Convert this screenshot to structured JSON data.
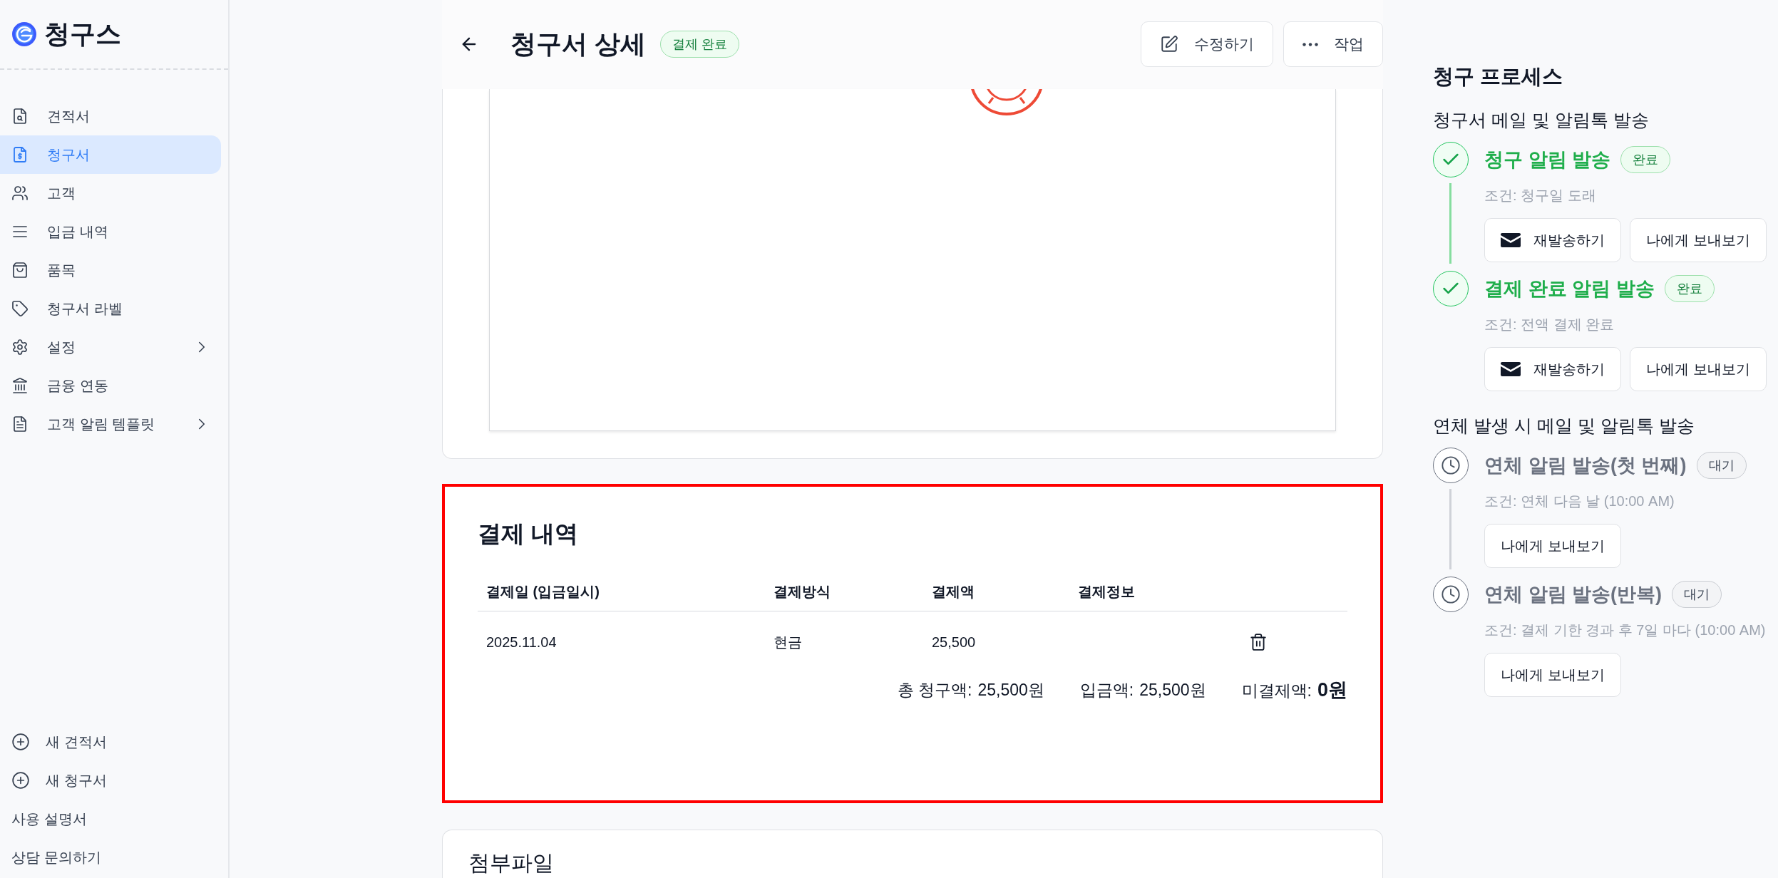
{
  "sidebar": {
    "logo": "청구스",
    "items": [
      {
        "label": "견적서",
        "selected": false,
        "expandable": false
      },
      {
        "label": "청구서",
        "selected": true,
        "expandable": false
      },
      {
        "label": "고객",
        "selected": false,
        "expandable": false
      },
      {
        "label": "입금 내역",
        "selected": false,
        "expandable": false
      },
      {
        "label": "품목",
        "selected": false,
        "expandable": false
      },
      {
        "label": "청구서 라벨",
        "selected": false,
        "expandable": false
      },
      {
        "label": "설정",
        "selected": false,
        "expandable": true
      },
      {
        "label": "금융 연동",
        "selected": false,
        "expandable": false
      },
      {
        "label": "고객 알림 템플릿",
        "selected": false,
        "expandable": true
      }
    ],
    "footer": [
      {
        "label": "새 견적서",
        "kind": "create"
      },
      {
        "label": "새 청구서",
        "kind": "create"
      },
      {
        "label": "사용 설명서",
        "kind": "link"
      },
      {
        "label": "상담 문의하기",
        "kind": "link"
      }
    ]
  },
  "header": {
    "title": "청구서 상세",
    "status_badge": "결제 완료",
    "actions": [
      {
        "label": "수정하기",
        "kind": "edit"
      },
      {
        "label": "작업",
        "kind": "more"
      }
    ]
  },
  "payments": {
    "title": "결제 내역",
    "highlighted": true,
    "columns": [
      "결제일 (입금일시)",
      "결제방식",
      "결제액",
      "결제정보"
    ],
    "rows": [
      {
        "date": "2025.11.04",
        "method": "현금",
        "amount": "25,500"
      }
    ],
    "totals": [
      {
        "label": "총 청구액:",
        "value": "25,500원",
        "emphasized": false
      },
      {
        "label": "입금액:",
        "value": "25,500원",
        "emphasized": false
      },
      {
        "label": "미결제액:",
        "value": "0원",
        "emphasized": true
      }
    ]
  },
  "attachments": {
    "title": "첨부파일"
  },
  "process": {
    "title": "청구 프로세스",
    "groups": [
      {
        "title": "청구서 메일 및 알림톡 발송",
        "steps": [
          {
            "title": "청구 알림 발송",
            "done": true,
            "badge": "완료",
            "condition": "조건: 청구일 도래",
            "buttons": [
              {
                "label": "재발송하기",
                "kind": "resend"
              },
              {
                "label": "나에게 보내보기",
                "kind": "preview"
              }
            ]
          },
          {
            "title": "결제 완료 알림 발송",
            "done": true,
            "badge": "완료",
            "condition": "조건: 전액 결제 완료",
            "buttons": [
              {
                "label": "재발송하기",
                "kind": "resend"
              },
              {
                "label": "나에게 보내보기",
                "kind": "preview"
              }
            ]
          }
        ]
      },
      {
        "title": "연체 발생 시 메일 및 알림톡 발송",
        "steps": [
          {
            "title": "연체 알림 발송(첫 번째)",
            "done": false,
            "badge": "대기",
            "condition": "조건: 연체 다음 날 (10:00 AM)",
            "buttons": [
              {
                "label": "나에게 보내보기",
                "kind": "preview"
              }
            ]
          },
          {
            "title": "연체 알림 발송(반복)",
            "done": false,
            "badge": "대기",
            "condition": "조건: 결제 기한 경과 후 7일 마다 (10:00 AM)",
            "buttons": [
              {
                "label": "나에게 보내보기",
                "kind": "preview"
              }
            ]
          }
        ]
      }
    ]
  }
}
